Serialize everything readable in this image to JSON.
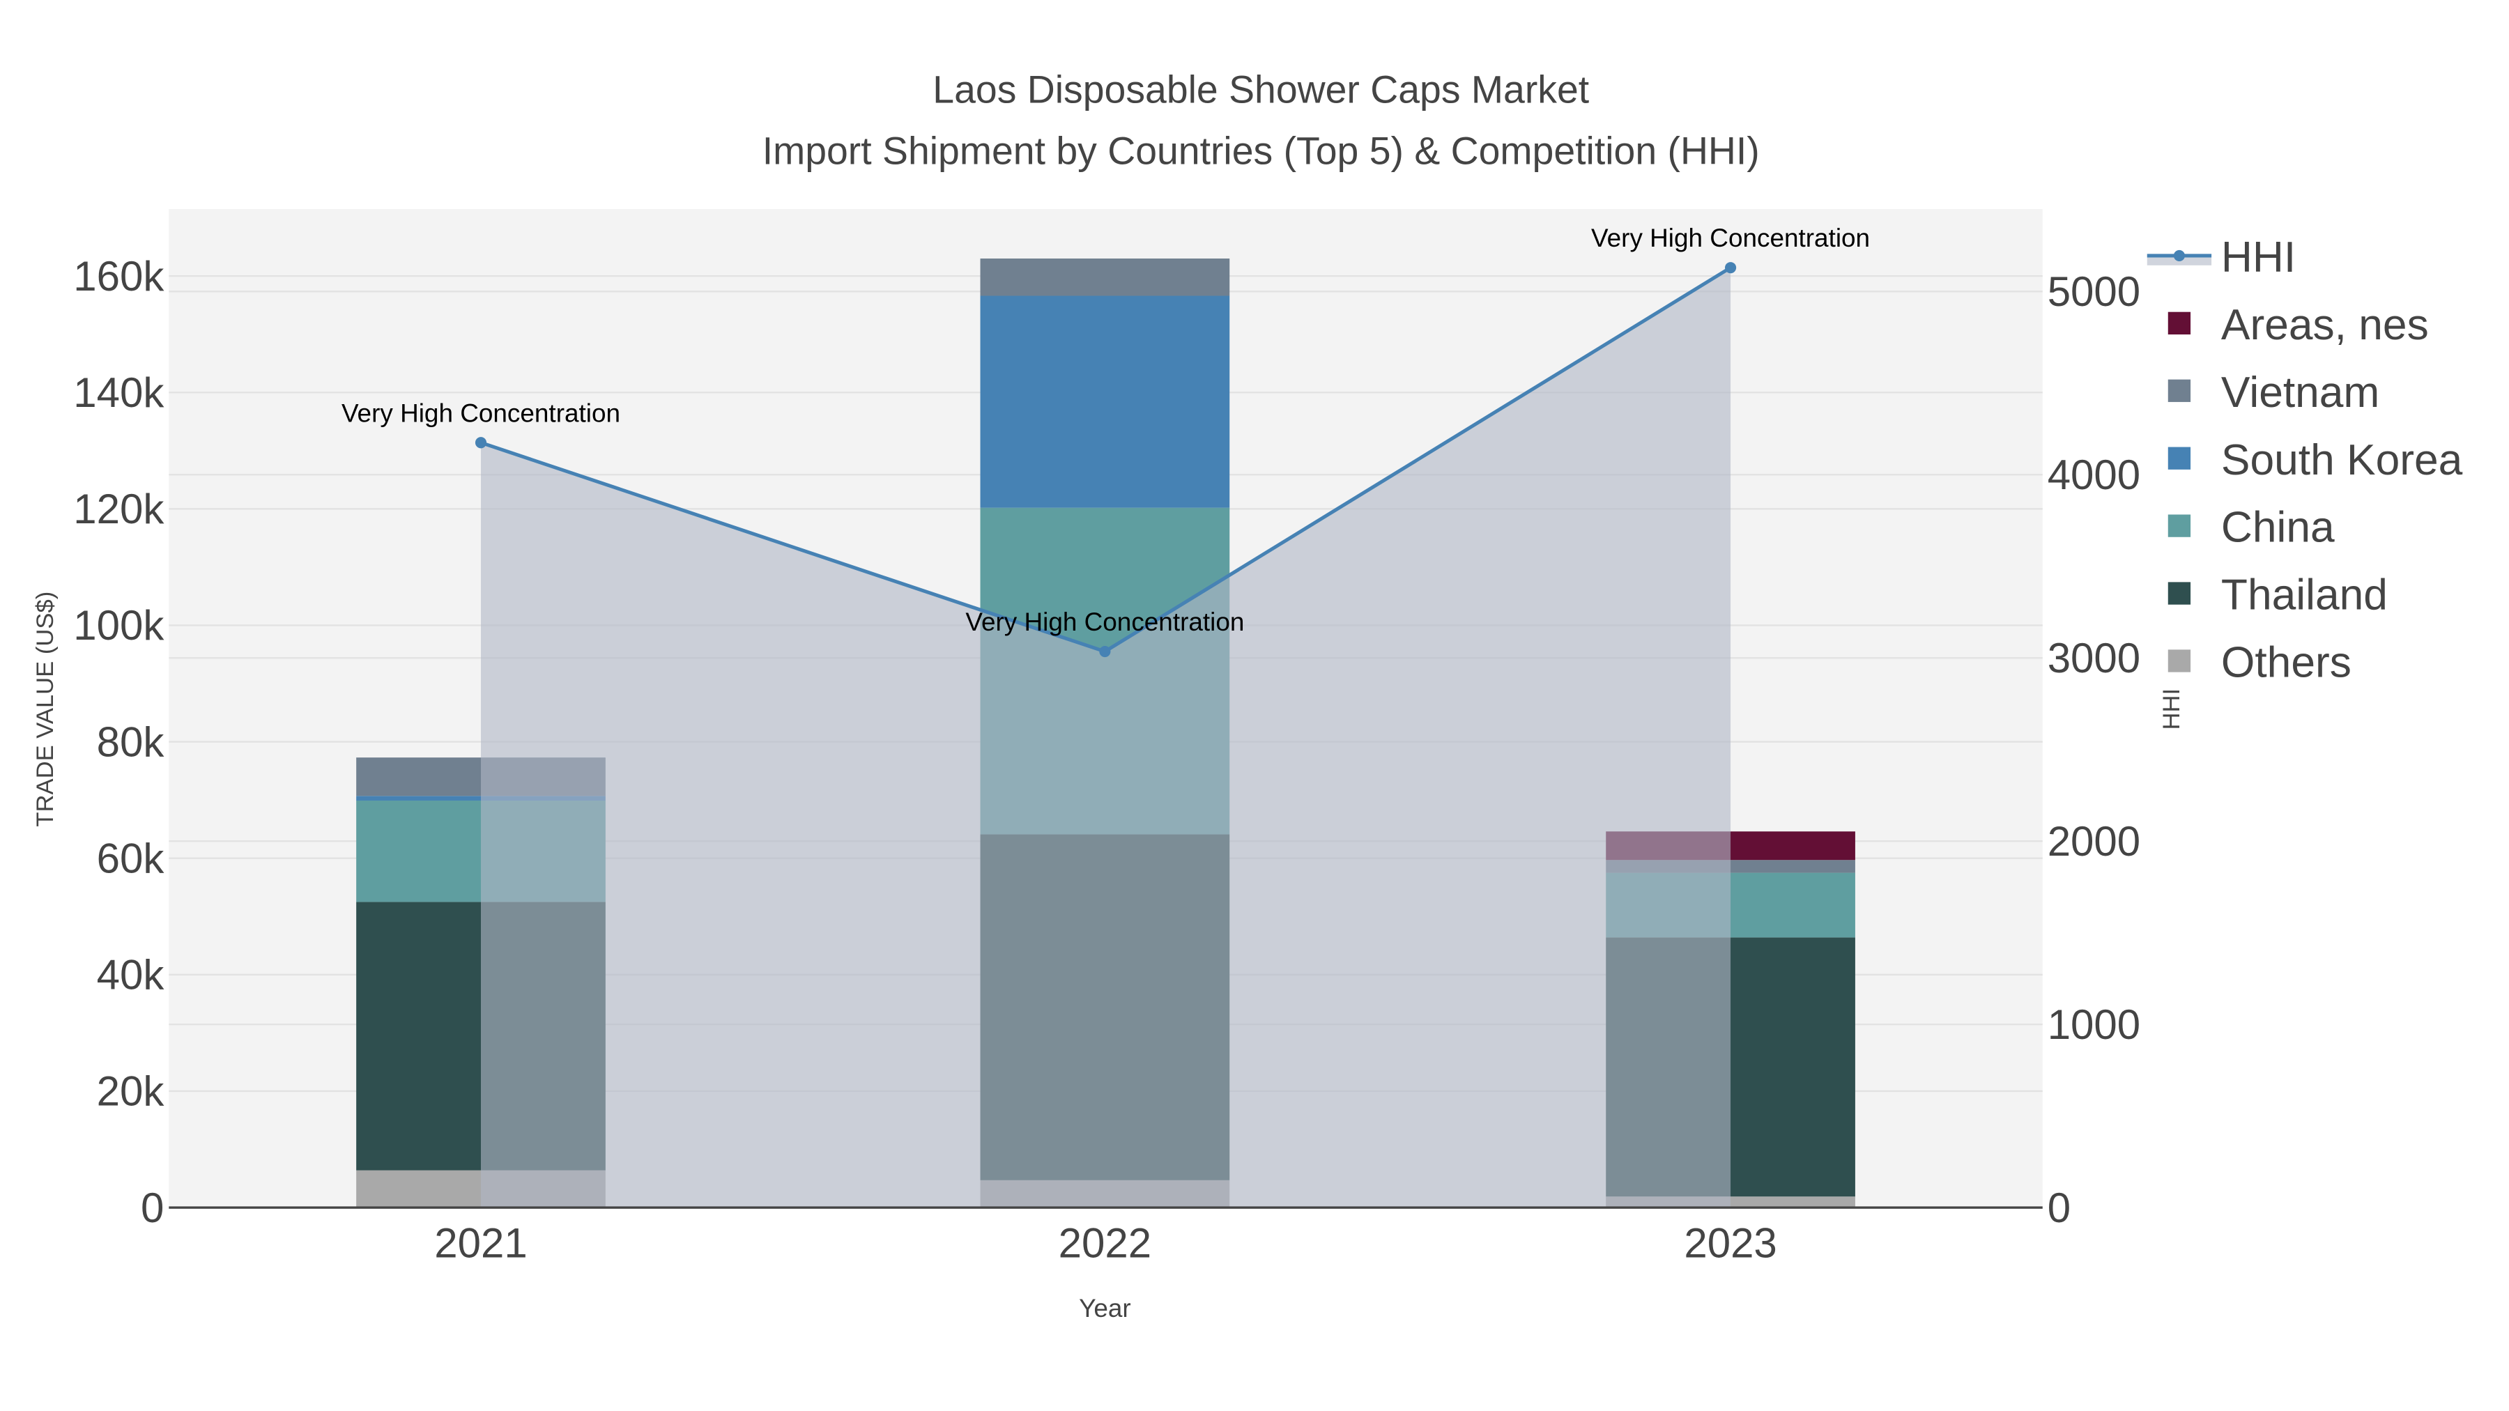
{
  "chart_data": {
    "type": "bar",
    "title": "Laos Disposable Shower Caps Market",
    "subtitle": "Import Shipment by Countries (Top 5) & Competition (HHI)",
    "xlabel": "Year",
    "ylabel": "TRADE VALUE (US$)",
    "y2label": "HHI",
    "categories": [
      "2021",
      "2022",
      "2023"
    ],
    "ylim": [
      0,
      171500
    ],
    "y2lim": [
      0,
      5450
    ],
    "yticks": [
      0,
      20000,
      40000,
      60000,
      80000,
      100000,
      120000,
      140000,
      160000
    ],
    "ytick_labels": [
      "0",
      "20k",
      "40k",
      "60k",
      "80k",
      "100k",
      "120k",
      "140k",
      "160k"
    ],
    "y2ticks": [
      0,
      1000,
      2000,
      3000,
      4000,
      5000
    ],
    "y2tick_labels": [
      "0",
      "1000",
      "2000",
      "3000",
      "4000",
      "5000"
    ],
    "series": [
      {
        "name": "Others",
        "color": "#a9a9a9",
        "values": [
          6400,
          4700,
          1900
        ]
      },
      {
        "name": "Thailand",
        "color": "#2f4f4f",
        "values": [
          46100,
          59400,
          44500
        ]
      },
      {
        "name": "China",
        "color": "#5f9ea0",
        "values": [
          17400,
          56100,
          11100
        ]
      },
      {
        "name": "South Korea",
        "color": "#4682b4",
        "values": [
          800,
          36400,
          0
        ]
      },
      {
        "name": "Vietnam",
        "color": "#708090",
        "values": [
          6600,
          6400,
          2200
        ]
      },
      {
        "name": "Areas, nes",
        "color": "#630f35",
        "values": [
          0,
          0,
          4900
        ]
      }
    ],
    "line": {
      "name": "HHI",
      "color": "#4682b4",
      "values": [
        4175,
        3035,
        5130
      ]
    },
    "annotations": [
      "Very High Concentration",
      "Very High Concentration",
      "Very High Concentration"
    ],
    "legend": [
      "HHI",
      "Areas, nes",
      "Vietnam",
      "South Korea",
      "China",
      "Thailand",
      "Others"
    ],
    "legend_position": "right",
    "grid": true
  }
}
